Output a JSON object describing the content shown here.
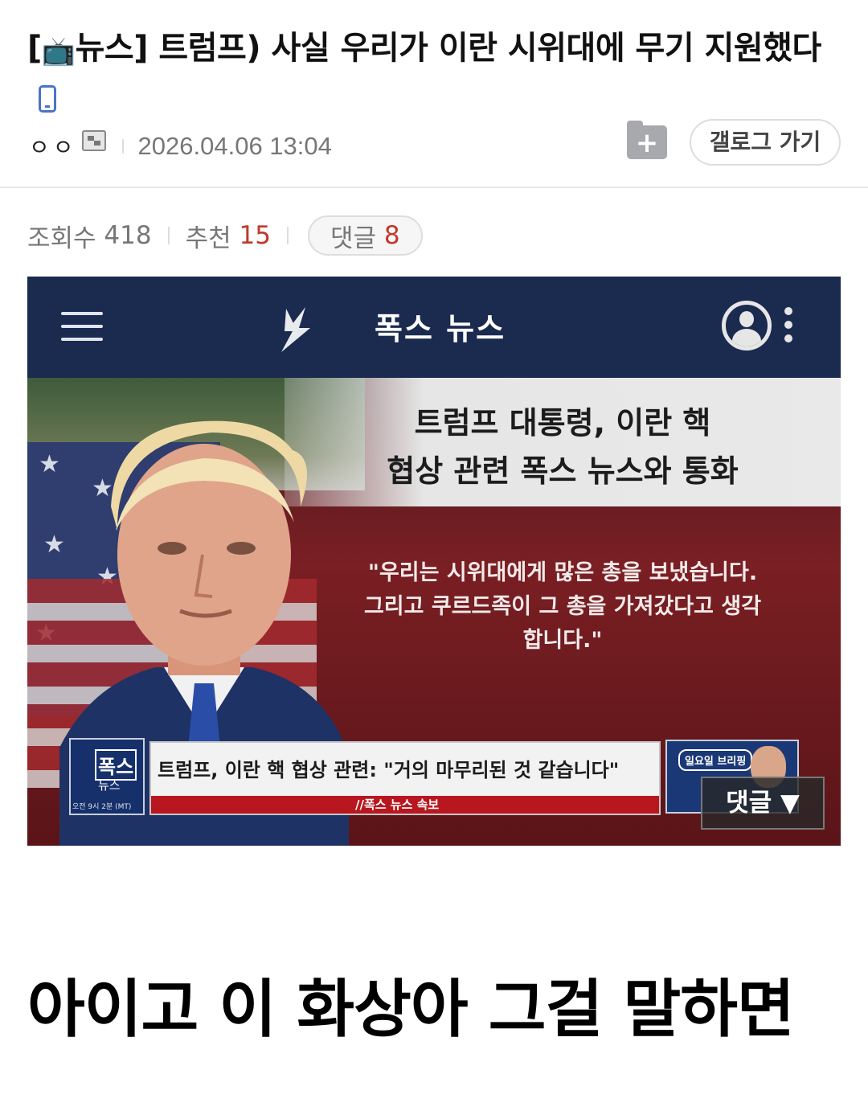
{
  "post": {
    "title_prefix": "[",
    "title_icon": "📺",
    "title_text": "뉴스] 트럼프) 사실 우리가 이란 시위대에 무기 지원했다",
    "author": "ㅇㅇ",
    "date": "2026.04.06 13:04",
    "gallery_button": "갤로그 가기"
  },
  "stats": {
    "views_label": "조회수",
    "views": "418",
    "recommend_label": "추천",
    "recommend": "15",
    "comments_label": "댓글",
    "comments": "8"
  },
  "media": {
    "app_title": "폭스 뉴스",
    "caption_line1": "트럼프 대통령, 이란 핵",
    "caption_line2": "협상 관련 폭스 뉴스와 통화",
    "quote_line1": "\"우리는 시위대에게 많은 총을 보냈습니다.",
    "quote_line2": "그리고 쿠르드족이 그 총을 가져갔다고 생각",
    "quote_line3": "합니다.\"",
    "logo_brand": "폭스",
    "logo_sub": "뉴스",
    "logo_time": "오전 9시 2분 (MT)",
    "headline": "트럼프, 이란 핵 협상 관련: \"거의 마무리된 것 같습니다\"",
    "breaking": "//폭스 뉴스 속보",
    "thumb_badge": "일요일 브리핑",
    "comment_overlay": "댓글 ▼"
  },
  "body": {
    "text": "아이고 이 화상아 그걸 말하면"
  },
  "colors": {
    "accent_red": "#c0392b",
    "app_bar": "#1b2a4f"
  },
  "icons": [
    "tv-icon",
    "phone-icon",
    "author-badge-icon",
    "folder-add-icon",
    "hamburger-icon",
    "fox-logo-icon",
    "profile-icon",
    "kebab-menu-icon"
  ]
}
